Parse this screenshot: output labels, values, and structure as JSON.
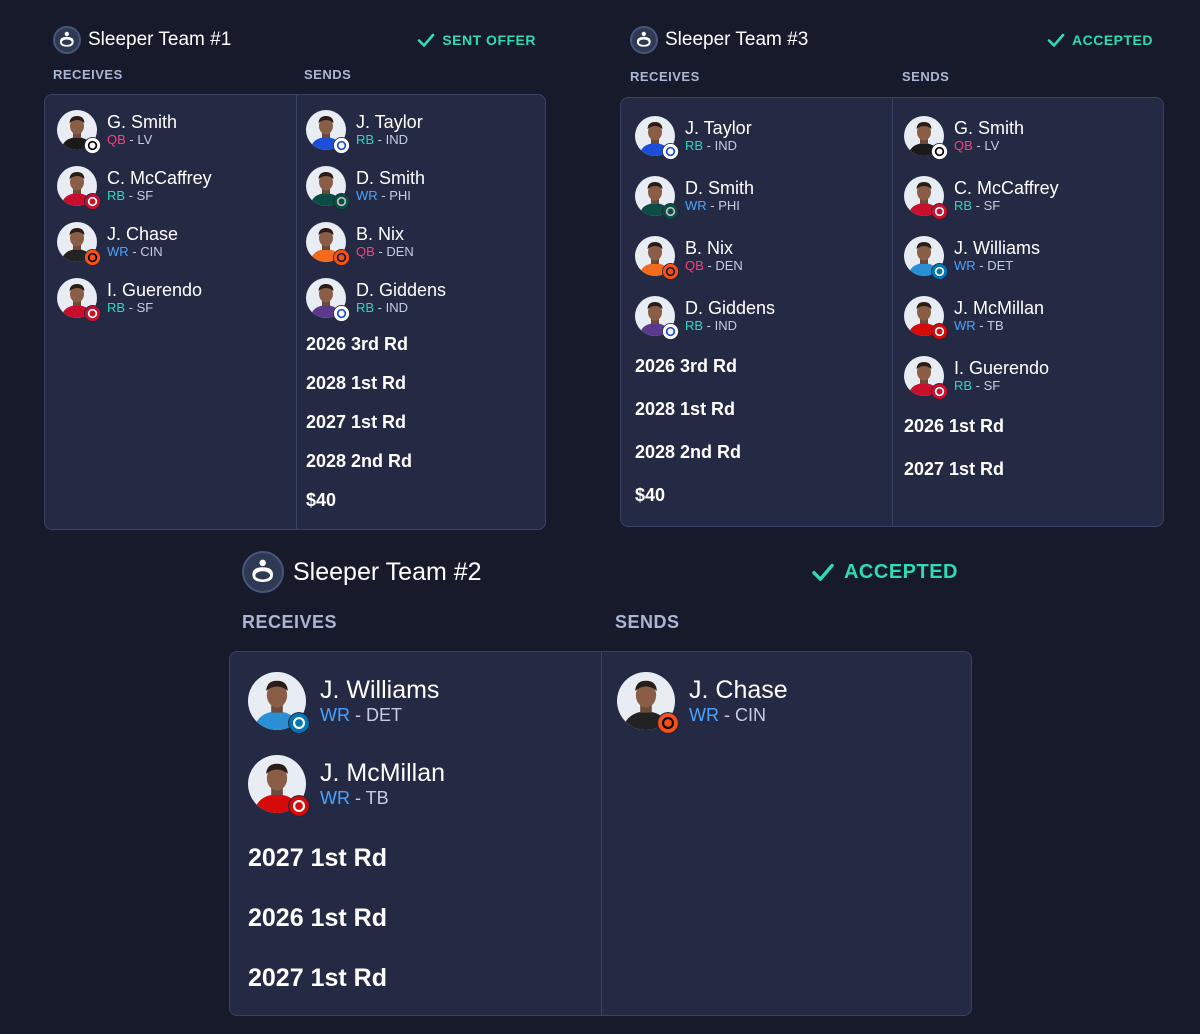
{
  "teams": [
    {
      "name": "Sleeper Team #1",
      "status": "SENT OFFER",
      "receives_label": "RECEIVES",
      "sends_label": "SENDS",
      "receives": {
        "players": [
          {
            "name": "G. Smith",
            "pos": "QB",
            "sep": " - ",
            "team": "LV",
            "jersey": "#1a1a1a",
            "badge": "raiders-logo"
          },
          {
            "name": "C. McCaffrey",
            "pos": "RB",
            "sep": " - ",
            "team": "SF",
            "jersey": "#c8102e",
            "badge": "49ers-logo"
          },
          {
            "name": "J. Chase",
            "pos": "WR",
            "sep": " - ",
            "team": "CIN",
            "jersey": "#222222",
            "badge": "bengals-logo"
          },
          {
            "name": "I. Guerendo",
            "pos": "RB",
            "sep": " - ",
            "team": "SF",
            "jersey": "#c8102e",
            "badge": "49ers-logo"
          }
        ],
        "picks": []
      },
      "sends": {
        "players": [
          {
            "name": "J. Taylor",
            "pos": "RB",
            "sep": " - ",
            "team": "IND",
            "jersey": "#1d4ed8",
            "badge": "colts-logo"
          },
          {
            "name": "D. Smith",
            "pos": "WR",
            "sep": " - ",
            "team": "PHI",
            "jersey": "#0b4d44",
            "badge": "eagles-logo"
          },
          {
            "name": "B. Nix",
            "pos": "QB",
            "sep": " - ",
            "team": "DEN",
            "jersey": "#f26b1d",
            "badge": "broncos-logo"
          },
          {
            "name": "D. Giddens",
            "pos": "RB",
            "sep": " - ",
            "team": "IND",
            "jersey": "#5b3a8e",
            "badge": "colts-logo"
          }
        ],
        "picks": [
          "2026 3rd Rd",
          "2028 1st Rd",
          "2027 1st Rd",
          "2028 2nd Rd",
          "$40"
        ]
      }
    },
    {
      "name": "Sleeper Team #3",
      "status": "ACCEPTED",
      "receives_label": "RECEIVES",
      "sends_label": "SENDS",
      "receives": {
        "players": [
          {
            "name": "J. Taylor",
            "pos": "RB",
            "sep": " - ",
            "team": "IND",
            "jersey": "#1d4ed8",
            "badge": "colts-logo"
          },
          {
            "name": "D. Smith",
            "pos": "WR",
            "sep": " - ",
            "team": "PHI",
            "jersey": "#0b4d44",
            "badge": "eagles-logo"
          },
          {
            "name": "B. Nix",
            "pos": "QB",
            "sep": " - ",
            "team": "DEN",
            "jersey": "#f26b1d",
            "badge": "broncos-logo"
          },
          {
            "name": "D. Giddens",
            "pos": "RB",
            "sep": " - ",
            "team": "IND",
            "jersey": "#5b3a8e",
            "badge": "colts-logo"
          }
        ],
        "picks": [
          "2026 3rd Rd",
          "2028 1st Rd",
          "2028 2nd Rd",
          "$40"
        ]
      },
      "sends": {
        "players": [
          {
            "name": "G. Smith",
            "pos": "QB",
            "sep": " - ",
            "team": "LV",
            "jersey": "#1a1a1a",
            "badge": "raiders-logo"
          },
          {
            "name": "C. McCaffrey",
            "pos": "RB",
            "sep": " - ",
            "team": "SF",
            "jersey": "#c8102e",
            "badge": "49ers-logo"
          },
          {
            "name": "J. Williams",
            "pos": "WR",
            "sep": " - ",
            "team": "DET",
            "jersey": "#2b8fd6",
            "badge": "lions-logo"
          },
          {
            "name": "J. McMillan",
            "pos": "WR",
            "sep": " - ",
            "team": "TB",
            "jersey": "#d50a0a",
            "badge": "buccaneers-logo"
          },
          {
            "name": "I. Guerendo",
            "pos": "RB",
            "sep": " - ",
            "team": "SF",
            "jersey": "#c8102e",
            "badge": "49ers-logo"
          }
        ],
        "picks": [
          "2026 1st Rd",
          "2027 1st Rd"
        ]
      }
    },
    {
      "name": "Sleeper Team #2",
      "status": "ACCEPTED",
      "receives_label": "RECEIVES",
      "sends_label": "SENDS",
      "receives": {
        "players": [
          {
            "name": "J. Williams",
            "pos": "WR",
            "sep": " - ",
            "team": "DET",
            "jersey": "#2b8fd6",
            "badge": "lions-logo"
          },
          {
            "name": "J. McMillan",
            "pos": "WR",
            "sep": " - ",
            "team": "TB",
            "jersey": "#d50a0a",
            "badge": "buccaneers-logo"
          }
        ],
        "picks": [
          "2027 1st Rd",
          "2026 1st Rd",
          "2027 1st Rd"
        ]
      },
      "sends": {
        "players": [
          {
            "name": "J. Chase",
            "pos": "WR",
            "sep": " - ",
            "team": "CIN",
            "jersey": "#222222",
            "badge": "bengals-logo"
          }
        ],
        "picks": []
      }
    }
  ],
  "colors": {
    "background": "#171a2b",
    "panel": "#242a43",
    "border": "#3a4263",
    "accent": "#2fdcb2",
    "label": "#a9b7d2",
    "qb": "#ff3d7d",
    "rb": "#2dd7bf",
    "wr": "#4aa3ff"
  },
  "icons": {
    "team_logo": "sleeper-logo-icon",
    "status": "check-icon"
  }
}
